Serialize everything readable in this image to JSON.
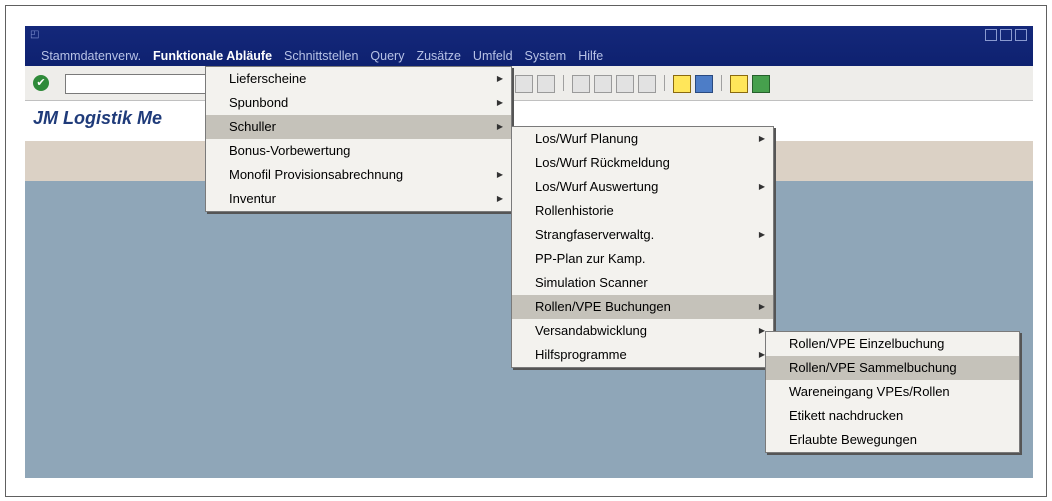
{
  "window": {
    "title_icon": "sap-logo-icon",
    "menubar": [
      {
        "label": "Stammdatenverw.",
        "active": false
      },
      {
        "label": "Funktionale Abläufe",
        "active": true
      },
      {
        "label": "Schnittstellen",
        "active": false
      },
      {
        "label": "Query",
        "active": false
      },
      {
        "label": "Zusätze",
        "active": false
      },
      {
        "label": "Umfeld",
        "active": false
      },
      {
        "label": "System",
        "active": false
      },
      {
        "label": "Hilfe",
        "active": false
      }
    ]
  },
  "toolbar": {
    "command_field_value": "",
    "icons": [
      "ok-icon",
      "find-icon",
      "find-next-icon",
      "first-page-icon",
      "prev-page-icon",
      "next-page-icon",
      "last-page-icon",
      "new-session-icon",
      "shortcut-icon",
      "help-icon",
      "layout-icon"
    ]
  },
  "header": {
    "app_title": "JM Logistik Me"
  },
  "menu_level1": [
    {
      "label": "Lieferscheine",
      "submenu": true
    },
    {
      "label": "Spunbond",
      "submenu": true
    },
    {
      "label": "Schuller",
      "submenu": true,
      "highlighted": true
    },
    {
      "label": "Bonus-Vorbewertung",
      "submenu": false
    },
    {
      "label": "Monofil Provisionsabrechnung",
      "submenu": true
    },
    {
      "label": "Inventur",
      "submenu": true
    }
  ],
  "menu_level2": [
    {
      "label": "Los/Wurf Planung",
      "submenu": true
    },
    {
      "label": "Los/Wurf Rückmeldung",
      "submenu": false
    },
    {
      "label": "Los/Wurf Auswertung",
      "submenu": true
    },
    {
      "label": "Rollenhistorie",
      "submenu": false
    },
    {
      "label": "Strangfaserverwaltg.",
      "submenu": true
    },
    {
      "label": "PP-Plan zur Kamp.",
      "submenu": false
    },
    {
      "label": "Simulation Scanner",
      "submenu": false
    },
    {
      "label": "Rollen/VPE Buchungen",
      "submenu": true,
      "highlighted": true
    },
    {
      "label": "Versandabwicklung",
      "submenu": true
    },
    {
      "label": "Hilfsprogramme",
      "submenu": true
    }
  ],
  "menu_level3": [
    {
      "label": "Rollen/VPE Einzelbuchung",
      "submenu": false
    },
    {
      "label": "Rollen/VPE Sammelbuchung",
      "submenu": false,
      "highlighted": true
    },
    {
      "label": "Wareneingang VPEs/Rollen",
      "submenu": false
    },
    {
      "label": "Etikett nachdrucken",
      "submenu": false
    },
    {
      "label": "Erlaubte Bewegungen",
      "submenu": false
    }
  ]
}
